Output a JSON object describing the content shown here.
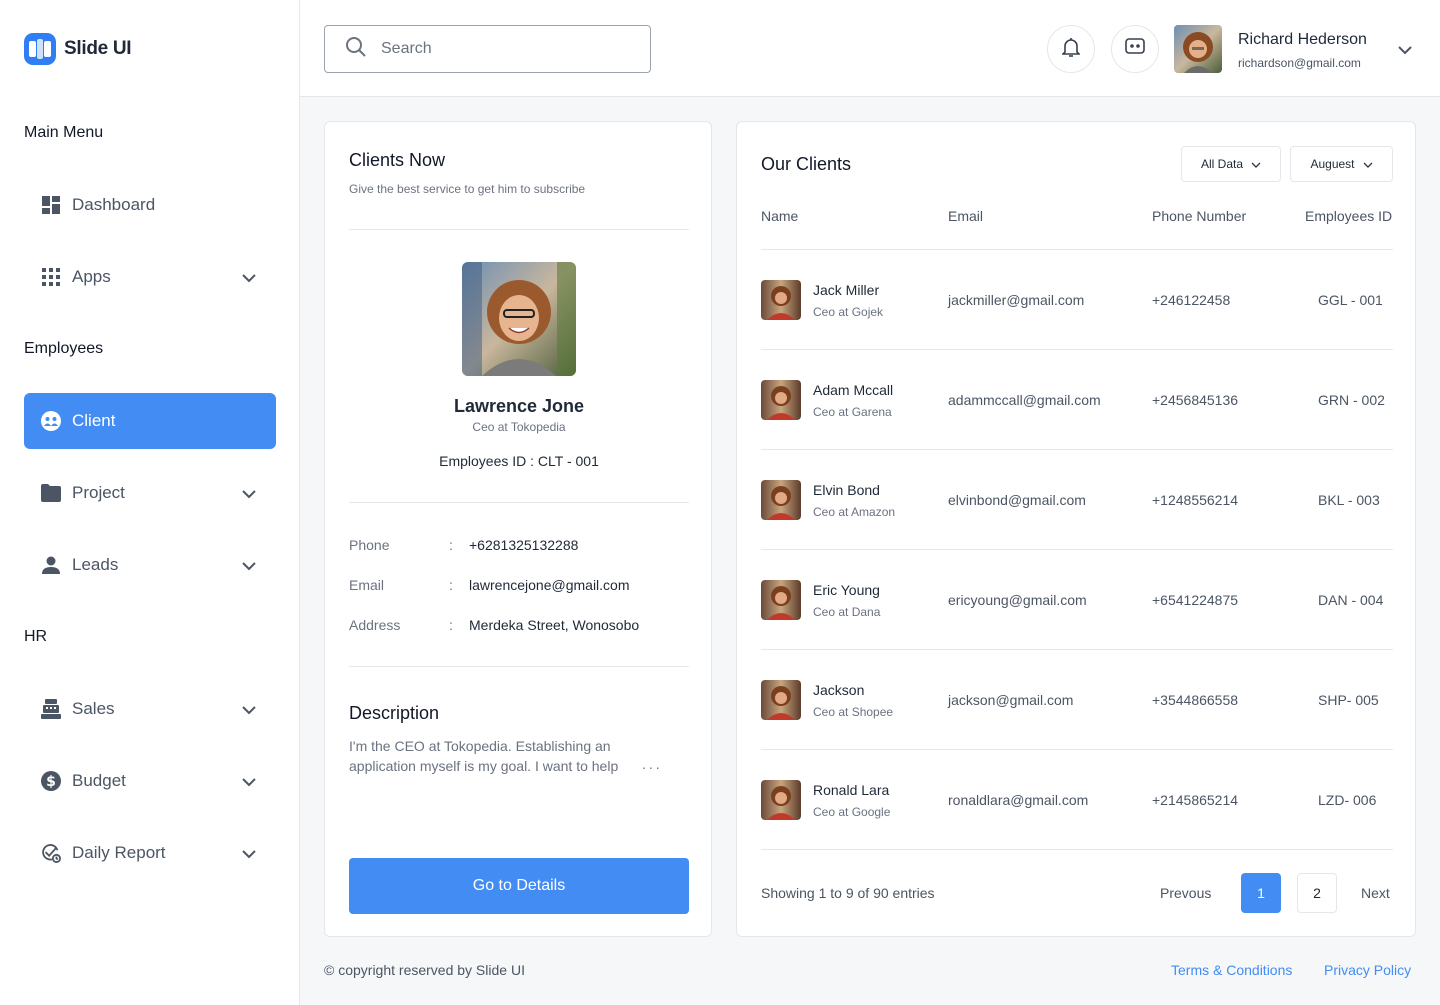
{
  "brand": {
    "name": "Slide UI",
    "accent": "#428cf4"
  },
  "sidebar": {
    "main_menu_title": "Main Menu",
    "employees_title": "Employees",
    "hr_title": "HR",
    "items": [
      {
        "label": "Dashboard",
        "icon": "dashboard-icon"
      },
      {
        "label": "Apps",
        "icon": "apps-grid-icon"
      },
      {
        "label": "Client",
        "icon": "client-icon",
        "active": true
      },
      {
        "label": "Project",
        "icon": "folder-icon"
      },
      {
        "label": "Leads",
        "icon": "person-icon"
      },
      {
        "label": "Sales",
        "icon": "cash-register-icon"
      },
      {
        "label": "Budget",
        "icon": "dollar-circle-icon"
      },
      {
        "label": "Daily Report",
        "icon": "check-clock-icon"
      }
    ]
  },
  "header": {
    "search_placeholder": "Search",
    "user": {
      "name": "Richard Hederson",
      "email": "richardson@gmail.com"
    }
  },
  "client_card": {
    "title": "Clients Now",
    "subtitle": "Give the best service to get him to subscribe",
    "name": "Lawrence Jone",
    "role": "Ceo at Tokopedia",
    "employee_id": "Employees ID : CLT - 001",
    "phone_label": "Phone",
    "phone": "+6281325132288",
    "email_label": "Email",
    "email": "lawrencejone@gmail.com",
    "address_label": "Address",
    "address": "Merdeka Street, Wonosobo",
    "colon": ":",
    "description_title": "Description",
    "description": "I'm the CEO at Tokopedia. Establishing an application myself is my goal. I want to help",
    "description_more": "...",
    "button": "Go to Details"
  },
  "clients_table": {
    "title": "Our Clients",
    "filter_all": "All Data",
    "filter_month": "Auguest",
    "columns": [
      "Name",
      "Email",
      "Phone Number",
      "Employees ID"
    ],
    "rows": [
      {
        "name": "Jack Miller",
        "role": "Ceo at Gojek",
        "email": "jackmiller@gmail.com",
        "phone": "+246122458",
        "eid": "GGL - 001"
      },
      {
        "name": "Adam Mccall",
        "role": "Ceo at Garena",
        "email": "adammccall@gmail.com",
        "phone": "+2456845136",
        "eid": "GRN - 002"
      },
      {
        "name": "Elvin Bond",
        "role": "Ceo at Amazon",
        "email": "elvinbond@gmail.com",
        "phone": "+1248556214",
        "eid": "BKL - 003"
      },
      {
        "name": "Eric Young",
        "role": "Ceo at Dana",
        "email": "ericyoung@gmail.com",
        "phone": "+6541224875",
        "eid": "DAN - 004"
      },
      {
        "name": "Jackson",
        "role": "Ceo at Shopee",
        "email": "jackson@gmail.com",
        "phone": "+3544866558",
        "eid": "SHP- 005"
      },
      {
        "name": "Ronald Lara",
        "role": "Ceo at Google",
        "email": "ronaldlara@gmail.com",
        "phone": "+2145865214",
        "eid": "LZD- 006"
      }
    ],
    "showing": "Showing 1 to 9 of 90 entries",
    "prev": "Prevous",
    "next": "Next",
    "pages": [
      "1",
      "2"
    ]
  },
  "footer": {
    "copyright": "© copyright reserved by Slide UI",
    "terms": "Terms & Conditions",
    "privacy": "Privacy Policy"
  }
}
